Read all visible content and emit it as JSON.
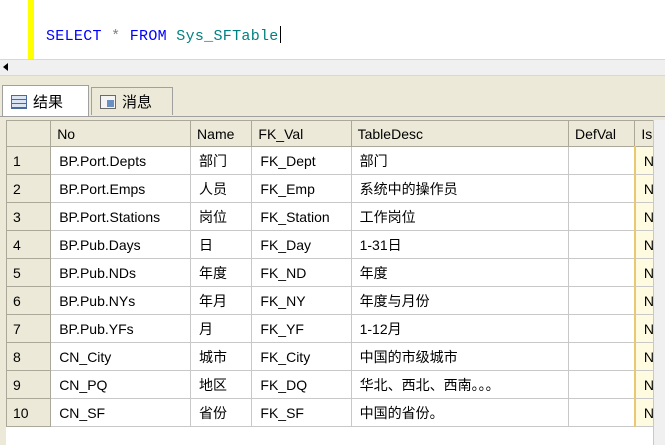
{
  "editor": {
    "sql": {
      "kw1": "SELECT",
      "op": "*",
      "kw2": "FROM",
      "obj": "Sys_SFTable"
    }
  },
  "tabs": [
    {
      "label": "结果"
    },
    {
      "label": "消息"
    }
  ],
  "grid": {
    "columns": [
      "No",
      "Name",
      "FK_Val",
      "TableDesc",
      "DefVal",
      "Is"
    ],
    "rows": [
      {
        "n": "1",
        "no": "BP.Port.Depts",
        "name": "部门",
        "fk": "FK_Dept",
        "desc": "部门",
        "defval": "",
        "is": "N"
      },
      {
        "n": "2",
        "no": "BP.Port.Emps",
        "name": "人员",
        "fk": "FK_Emp",
        "desc": "系统中的操作员",
        "defval": "",
        "is": "N"
      },
      {
        "n": "3",
        "no": "BP.Port.Stations",
        "name": "岗位",
        "fk": "FK_Station",
        "desc": "工作岗位",
        "defval": "",
        "is": "N"
      },
      {
        "n": "4",
        "no": "BP.Pub.Days",
        "name": "日",
        "fk": "FK_Day",
        "desc": "1-31日",
        "defval": "",
        "is": "N"
      },
      {
        "n": "5",
        "no": "BP.Pub.NDs",
        "name": "年度",
        "fk": "FK_ND",
        "desc": "年度",
        "defval": "",
        "is": "N"
      },
      {
        "n": "6",
        "no": "BP.Pub.NYs",
        "name": "年月",
        "fk": "FK_NY",
        "desc": "年度与月份",
        "defval": "",
        "is": "N"
      },
      {
        "n": "7",
        "no": "BP.Pub.YFs",
        "name": "月",
        "fk": "FK_YF",
        "desc": "1-12月",
        "defval": "",
        "is": "N"
      },
      {
        "n": "8",
        "no": "CN_City",
        "name": "城市",
        "fk": "FK_City",
        "desc": "中国的市级城市",
        "defval": "",
        "is": "N"
      },
      {
        "n": "9",
        "no": "CN_PQ",
        "name": "地区",
        "fk": "FK_DQ",
        "desc": "华北、西北、西南。。。",
        "defval": "",
        "is": "N"
      },
      {
        "n": "10",
        "no": "CN_SF",
        "name": "省份",
        "fk": "FK_SF",
        "desc": "中国的省份。",
        "defval": "",
        "is": "N"
      }
    ]
  }
}
